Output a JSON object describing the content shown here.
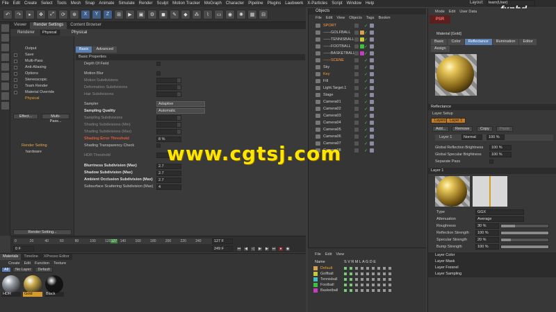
{
  "menubar": [
    "File",
    "Edit",
    "Create",
    "Select",
    "Tools",
    "Mesh",
    "Snap",
    "Animate",
    "Simulate",
    "Render",
    "Sculpt",
    "Motion Tracker",
    "MoGraph",
    "Character",
    "Pipeline",
    "Plugins",
    "Laubwerk",
    "X-Particles",
    "Script",
    "Window",
    "Help"
  ],
  "layout": {
    "label": "Layout:",
    "value": "learn(User)"
  },
  "logo": "fxphd",
  "toolbar": {
    "psr_label": "PSR",
    "psr_value": "0"
  },
  "render_settings": {
    "tabs": [
      "Viewer",
      "Render Settings",
      "Content Browser"
    ],
    "renderer_label": "Renderer",
    "renderer_value": "Physical",
    "section": "Physical",
    "subtabs": [
      "Basic",
      "Advanced"
    ],
    "list": [
      "Output",
      "Save",
      "Multi-Pass",
      "Anti-Aliasing",
      "Options",
      "Stereoscopic",
      "Team Render",
      "Material Override",
      "Physical"
    ],
    "effect_btn": "Effect...",
    "multipass_btn": "Multi-Pass...",
    "tree": [
      "Render Setting",
      "hardware"
    ],
    "bottom_btn": "Render Setting...",
    "basic_props": "Basic Properties",
    "rows": {
      "depth_of_field": "Depth Of Field",
      "motion_blur": "Motion Blur",
      "motion_sub": "Motion Subdivisions",
      "deform_sub": "Deformation Subdivisions",
      "hair_sub": "Hair Subdivisions",
      "sampler": "Sampler",
      "sampler_val": "Adaptive",
      "sampling_quality": "Sampling Quality",
      "sampling_quality_val": "Automatic",
      "sampling_sub": "Sampling Subdivisions",
      "shading_min": "Shading Subdivisions (Min)",
      "shading_max": "Shading Subdivisions (Max)",
      "shading_error": "Shading Error Threshold",
      "shading_error_val": "8 %",
      "shading_trans": "Shading Transparency Check",
      "hdr_thresh": "HDR Threshold",
      "blurriness": "Blurriness Subdivision (Max)",
      "blurriness_val": "2.7",
      "shadow": "Shadow Subdivision (Max)",
      "shadow_val": "2.7",
      "ao": "Ambient Occlusion Subdivision (Max)",
      "ao_val": "2.7",
      "sss": "Subsurface Scattering Subdivision (Max)",
      "sss_val": "4"
    }
  },
  "timeline": {
    "ticks": [
      "0",
      "20",
      "40",
      "60",
      "80",
      "100",
      "120",
      "127",
      "140",
      "160",
      "180",
      "200",
      "220",
      "240"
    ],
    "current": "127 40",
    "start": "0 F",
    "end_a": "127 F",
    "end_b": "249 F"
  },
  "materials": {
    "tabs": [
      "Materials",
      "Timeline",
      "XPresso Editor"
    ],
    "menu": [
      "Create",
      "Edit",
      "Function",
      "Texture"
    ],
    "filters": [
      "All",
      "No Layer",
      "Default"
    ],
    "items": [
      {
        "name": "HDR",
        "color": "#9aa0a8"
      },
      {
        "name": "Gold",
        "color": "#c9a84a"
      },
      {
        "name": "Black",
        "color": "#151515"
      }
    ]
  },
  "objects": {
    "title": "Objects",
    "menu": [
      "File",
      "Edit",
      "View",
      "Objects",
      "Tags",
      "Bookm"
    ],
    "rows": [
      {
        "name": "SPORT",
        "type": "layer"
      },
      {
        "name": "------GOLFBALL",
        "type": "null",
        "tag": "#d8a050"
      },
      {
        "name": "------TENNISBALL",
        "type": "null",
        "tag": "#c8c840"
      },
      {
        "name": "------FOOTBALL",
        "type": "null",
        "tag": "#40c040"
      },
      {
        "name": "------BASKETBALL",
        "type": "null",
        "tag": "#c040c0"
      },
      {
        "name": "------SCENE",
        "type": "layer"
      },
      {
        "name": "Sky",
        "type": "obj"
      },
      {
        "name": "Key",
        "type": "sel"
      },
      {
        "name": "Fill",
        "type": "obj"
      },
      {
        "name": "Light.Target.1",
        "type": "obj"
      },
      {
        "name": "Stage",
        "type": "obj"
      },
      {
        "name": "Camera01",
        "type": "obj"
      },
      {
        "name": "Camera02",
        "type": "obj"
      },
      {
        "name": "Camera03",
        "type": "obj"
      },
      {
        "name": "Camera04",
        "type": "obj"
      },
      {
        "name": "Camera05",
        "type": "obj"
      },
      {
        "name": "Camera06",
        "type": "obj"
      },
      {
        "name": "Camera07",
        "type": "obj"
      },
      {
        "name": "Camera08",
        "type": "obj"
      }
    ]
  },
  "layers": {
    "menu": [
      "File",
      "Edit",
      "View"
    ],
    "header": "Name",
    "cols": "S V R M L A G D E",
    "rows": [
      {
        "name": "Default",
        "color": "#d8a050",
        "sel": true
      },
      {
        "name": "Golfball",
        "color": "#c8c840"
      },
      {
        "name": "Tennisball",
        "color": "#40c0c0"
      },
      {
        "name": "Football",
        "color": "#40c040"
      },
      {
        "name": "Basketball",
        "color": "#c040c0"
      }
    ]
  },
  "attributes": {
    "menu": [
      "Mode",
      "Edit",
      "User Data"
    ],
    "title": "Material [Gold]",
    "tabs": [
      "Basic",
      "Color",
      "Reflectance",
      "Illumination",
      "Editor"
    ],
    "tab_assign": "Assign",
    "reflectance": "Reflectance",
    "layer_setup": "Layer Setup",
    "layers_btn": "Layers",
    "layer1_btn": "Layer 1",
    "add_btn": "Add...",
    "remove_btn": "Remove",
    "copy_btn": "Copy",
    "paste_btn": "Paste",
    "layer_row": "Layer 1",
    "blend": "Normal",
    "opacity": "100 %",
    "global_refl": "Global Reflection Brightness",
    "global_refl_val": "100 %",
    "global_spec": "Global Specular Brightness",
    "global_spec_val": "100 %",
    "sep_pass": "Separate Pass",
    "layer1_section": "Layer 1",
    "type_label": "Type",
    "type_val": "GGX",
    "atten_label": "Attenuation",
    "atten_val": "Average",
    "rough_label": "Roughness",
    "rough_val": "30 %",
    "rough_frac": 0.3,
    "refl_str_label": "Reflection Strength",
    "refl_str_val": "100 %",
    "refl_frac": 1.0,
    "spec_str_label": "Specular Strength",
    "spec_str_val": "20 %",
    "spec_frac": 0.2,
    "bump_label": "Bump Strength",
    "bump_val": "100 %",
    "bump_frac": 1.0,
    "groups": [
      "Layer Color",
      "Layer Mask",
      "Layer Fresnel",
      "Layer Sampling"
    ]
  },
  "watermark": "www.cgtsj.com",
  "colors": {
    "accent": "#5a7fb0",
    "highlight": "#f0a030",
    "error": "#e35a3a",
    "gold": "#c9a84a"
  }
}
